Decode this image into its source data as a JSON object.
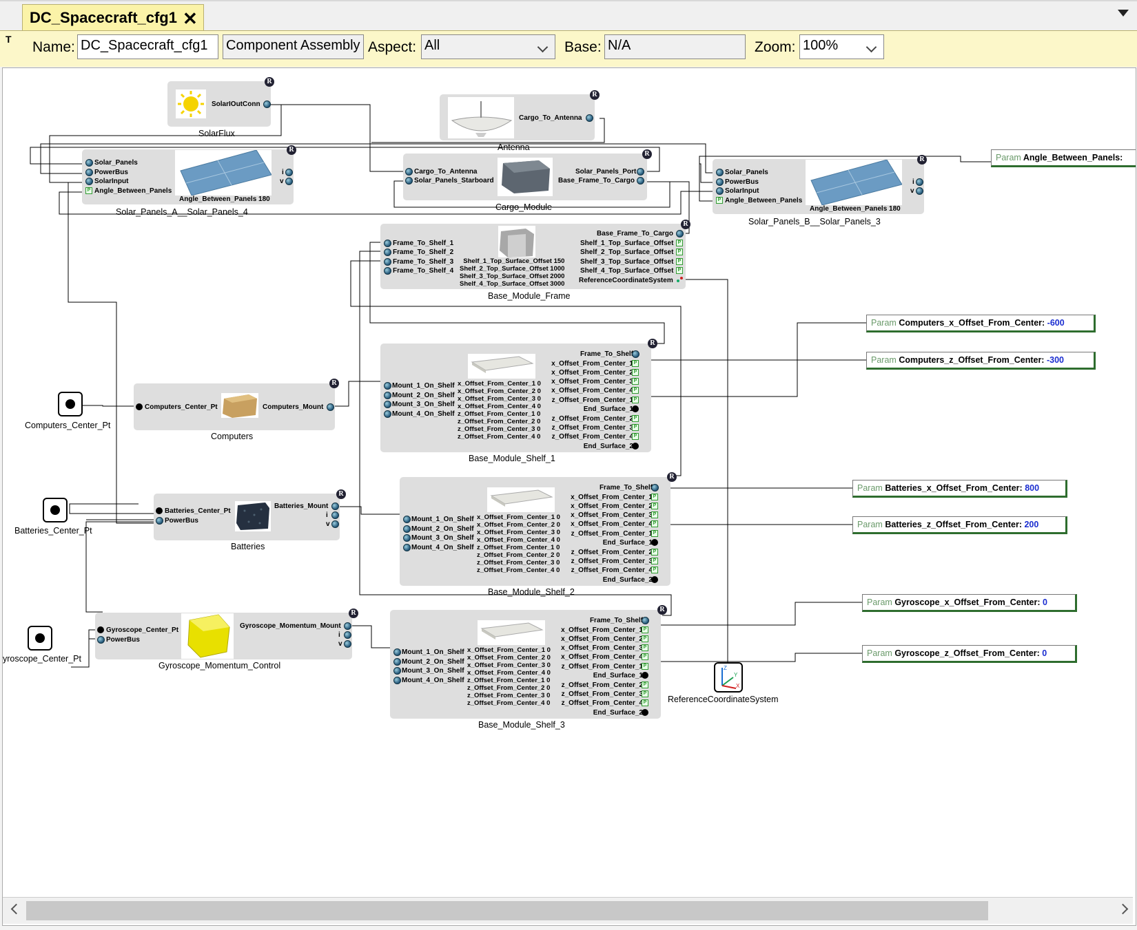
{
  "tab": {
    "title": "DC_Spacecraft_cfg1",
    "close": "✕"
  },
  "props": {
    "t_icon": "T",
    "name_label": "Name:",
    "name_value": "DC_Spacecraft_cfg1",
    "kind": "Component Assembly",
    "aspect_label": "Aspect:",
    "aspect_value": "All",
    "base_label": "Base:",
    "base_value": "N/A",
    "zoom_label": "Zoom:",
    "zoom_value": "100%"
  },
  "blocks": {
    "solarflux": {
      "name": "SolarFlux",
      "port": "SolarIOutConn"
    },
    "antenna": {
      "name": "Antenna",
      "port": "Cargo_To_Antenna"
    },
    "solar_a": {
      "name": "Solar_Panels_A__Solar_Panels_4",
      "ports": [
        "Solar_Panels",
        "PowerBus",
        "SolarInput",
        "Angle_Between_Panels"
      ],
      "right": [
        "i",
        "v"
      ],
      "param": "Angle_Between_Panels 180"
    },
    "cargo": {
      "name": "Cargo_Module",
      "left": [
        "Cargo_To_Antenna",
        "Solar_Panels_Starboard"
      ],
      "right": [
        "Solar_Panels_Port",
        "Base_Frame_To_Cargo"
      ]
    },
    "solar_b": {
      "name": "Solar_Panels_B__Solar_Panels_3",
      "ports": [
        "Solar_Panels",
        "PowerBus",
        "SolarInput",
        "Angle_Between_Panels"
      ],
      "right": [
        "i",
        "v"
      ],
      "param": "Angle_Between_Panels 180"
    },
    "frame": {
      "name": "Base_Module_Frame",
      "left": [
        "Frame_To_Shelf_1",
        "Frame_To_Shelf_2",
        "Frame_To_Shelf_3",
        "Frame_To_Shelf_4"
      ],
      "right": [
        "Base_Frame_To_Cargo",
        "Shelf_1_Top_Surface_Offset",
        "Shelf_2_Top_Surface_Offset",
        "Shelf_3_Top_Surface_Offset",
        "Shelf_4_Top_Surface_Offset",
        "ReferenceCoordinateSystem"
      ],
      "params": "Shelf_1_Top_Surface_Offset 150\nShelf_2_Top_Surface_Offset 1000\nShelf_3_Top_Surface_Offset 2000\nShelf_4_Top_Surface_Offset 3000"
    },
    "computers": {
      "name": "Computers",
      "left": "Computers_Center_Pt",
      "right": "Computers_Mount"
    },
    "batteries": {
      "name": "Batteries",
      "left": [
        "Batteries_Center_Pt",
        "PowerBus"
      ],
      "right": [
        "Batteries_Mount",
        "i",
        "v"
      ]
    },
    "gyro": {
      "name": "Gyroscope_Momentum_Control",
      "left": [
        "Gyroscope_Center_Pt",
        "PowerBus"
      ],
      "right": [
        "Gyroscope_Momentum_Mount",
        "i",
        "v"
      ]
    },
    "shelf_left": [
      "Mount_1_On_Shelf",
      "Mount_2_On_Shelf",
      "Mount_3_On_Shelf",
      "Mount_4_On_Shelf"
    ],
    "shelf_right": [
      "Frame_To_Shelf",
      "x_Offset_From_Center_1",
      "x_Offset_From_Center_2",
      "x_Offset_From_Center_3",
      "x_Offset_From_Center_4",
      "z_Offset_From_Center_1",
      "End_Surface_1",
      "z_Offset_From_Center_2",
      "z_Offset_From_Center_3",
      "z_Offset_From_Center_4",
      "End_Surface_2"
    ],
    "shelf_params": "x_Offset_From_Center_1 0\nx_Offset_From_Center_2 0\nx_Offset_From_Center_3 0\nx_Offset_From_Center_4 0\nz_Offset_From_Center_1 0\nz_Offset_From_Center_2 0\nz_Offset_From_Center_3 0\nz_Offset_From_Center_4 0",
    "shelf1": {
      "name": "Base_Module_Shelf_1"
    },
    "shelf2": {
      "name": "Base_Module_Shelf_2"
    },
    "shelf3": {
      "name": "Base_Module_Shelf_3"
    }
  },
  "points": {
    "computers": "Computers_Center_Pt",
    "batteries": "Batteries_Center_Pt",
    "gyro": "yroscope_Center_Pt"
  },
  "refsys": {
    "name": "ReferenceCoordinateSystem",
    "axes": [
      "Z",
      "Y",
      "X"
    ]
  },
  "params": {
    "kind": "Param",
    "angle": {
      "name": "Angle_Between_Panels:",
      "value": ""
    },
    "cx": {
      "name": "Computers_x_Offset_From_Center:",
      "value": "-600"
    },
    "cz": {
      "name": "Computers_z_Offset_From_Center:",
      "value": "-300"
    },
    "bx": {
      "name": "Batteries_x_Offset_From_Center:",
      "value": "800"
    },
    "bz": {
      "name": "Batteries_z_Offset_From_Center:",
      "value": "200"
    },
    "gx": {
      "name": "Gyroscope_x_Offset_From_Center:",
      "value": "0"
    },
    "gz": {
      "name": "Gyroscope_z_Offset_From_Center:",
      "value": "0"
    }
  },
  "colors": {
    "tab": "#fbf3a8",
    "block": "#dedede",
    "param_border": "#2e6d2e",
    "param_value": "#1a2dd0"
  }
}
